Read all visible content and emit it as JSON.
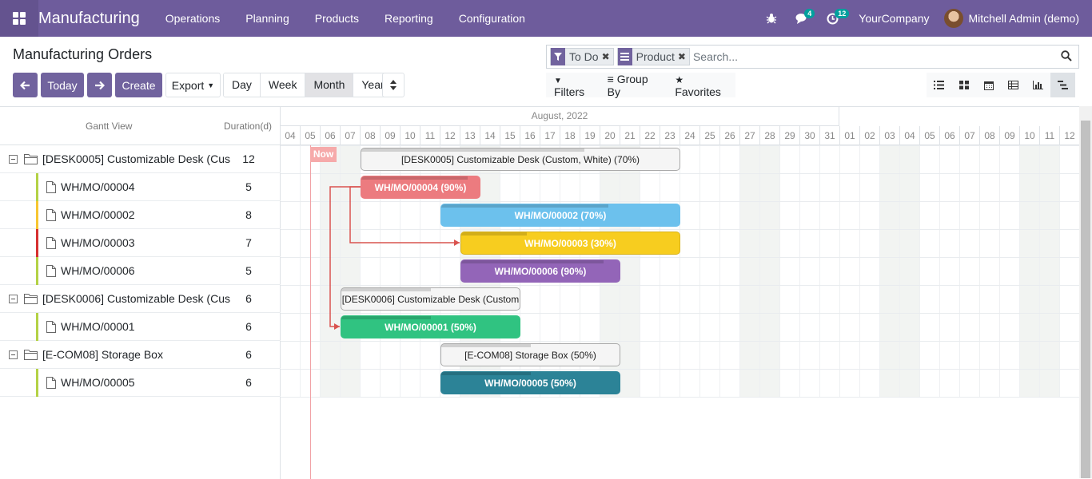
{
  "navbar": {
    "brand": "Manufacturing",
    "menu": [
      "Operations",
      "Planning",
      "Products",
      "Reporting",
      "Configuration"
    ],
    "messages_count": "4",
    "activities_count": "12",
    "company": "YourCompany",
    "user": "Mitchell Admin (demo)"
  },
  "control": {
    "title": "Manufacturing Orders",
    "today": "Today",
    "create": "Create",
    "export": "Export",
    "scales": [
      "Day",
      "Week",
      "Month",
      "Year"
    ],
    "active_scale": "Month",
    "facets": [
      "To Do",
      "Product"
    ],
    "search_placeholder": "Search...",
    "filters": "Filters",
    "group_by": "Group By",
    "favorites": "Favorites"
  },
  "gantt": {
    "left_header": "Gantt View",
    "duration_header": "Duration(d)",
    "month": "August, 2022",
    "now_label": "Now",
    "days": [
      "04",
      "05",
      "06",
      "07",
      "08",
      "09",
      "10",
      "11",
      "12",
      "13",
      "14",
      "15",
      "16",
      "17",
      "18",
      "19",
      "20",
      "21",
      "22",
      "23",
      "24",
      "25",
      "26",
      "27",
      "28",
      "29",
      "30",
      "31",
      "01",
      "02",
      "03",
      "04",
      "05",
      "06",
      "07",
      "08",
      "09",
      "10",
      "11",
      "12"
    ],
    "weekend_indexes": [
      2,
      3,
      9,
      10,
      16,
      17,
      23,
      24,
      30,
      31,
      37,
      38
    ],
    "rows": [
      {
        "type": "group",
        "name": "[DESK0005] Customizable Desk (Cus",
        "duration": "12"
      },
      {
        "type": "item",
        "name": "WH/MO/00004",
        "duration": "5",
        "color": "#b4d245"
      },
      {
        "type": "item",
        "name": "WH/MO/00002",
        "duration": "8",
        "color": "#f7c631"
      },
      {
        "type": "item",
        "name": "WH/MO/00003",
        "duration": "7",
        "color": "#d63030"
      },
      {
        "type": "item",
        "name": "WH/MO/00006",
        "duration": "5",
        "color": "#b4d245"
      },
      {
        "type": "group",
        "name": "[DESK0006] Customizable Desk (Cus",
        "duration": "6"
      },
      {
        "type": "item",
        "name": "WH/MO/00001",
        "duration": "6",
        "color": "#b4d245"
      },
      {
        "type": "group",
        "name": "[E-COM08] Storage Box",
        "duration": "6"
      },
      {
        "type": "item",
        "name": "WH/MO/00005",
        "duration": "6",
        "color": "#b4d245"
      }
    ],
    "pills": [
      {
        "label": "[DESK0005] Customizable Desk (Custom, White) (70%)",
        "row": 0,
        "start": 4,
        "span": 16,
        "bg": "#f5f5f5",
        "fg": "#222",
        "border": "#aaa",
        "progress": 0.7
      },
      {
        "label": "WH/MO/00004 (90%)",
        "row": 1,
        "start": 4,
        "span": 6,
        "bg": "#ec7b7f",
        "fg": "#fff",
        "border": "#ec7b7f",
        "progress": 0.9
      },
      {
        "label": "WH/MO/00002 (70%)",
        "row": 2,
        "start": 8,
        "span": 12,
        "bg": "#6cc1ed",
        "fg": "#fff",
        "border": "#6cc1ed",
        "progress": 0.7
      },
      {
        "label": "WH/MO/00003 (30%)",
        "row": 3,
        "start": 9,
        "span": 11,
        "bg": "#f7cd1f",
        "fg": "#fff",
        "border": "#d9b31a",
        "progress": 0.3
      },
      {
        "label": "WH/MO/00006 (90%)",
        "row": 4,
        "start": 9,
        "span": 8,
        "bg": "#9365b8",
        "fg": "#fff",
        "border": "#9365b8",
        "progress": 0.9
      },
      {
        "label": "[DESK0006] Customizable Desk (Custom",
        "row": 5,
        "start": 3,
        "span": 9,
        "bg": "#f5f5f5",
        "fg": "#222",
        "border": "#aaa",
        "progress": 0.5
      },
      {
        "label": "WH/MO/00001 (50%)",
        "row": 6,
        "start": 3,
        "span": 9,
        "bg": "#30c381",
        "fg": "#fff",
        "border": "#30c381",
        "progress": 0.5
      },
      {
        "label": "[E-COM08] Storage Box (50%)",
        "row": 7,
        "start": 8,
        "span": 9,
        "bg": "#f5f5f5",
        "fg": "#222",
        "border": "#aaa",
        "progress": 0.5
      },
      {
        "label": "WH/MO/00005 (50%)",
        "row": 8,
        "start": 8,
        "span": 9,
        "bg": "#2c8397",
        "fg": "#fff",
        "border": "#2c8397",
        "progress": 0.5
      }
    ],
    "dependency_color": "#d9534f"
  }
}
